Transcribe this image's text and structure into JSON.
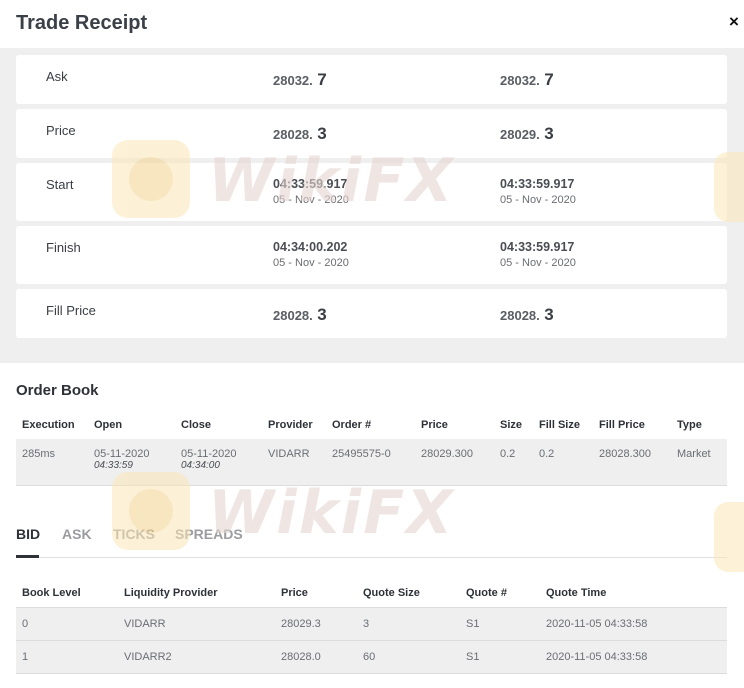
{
  "modal": {
    "title": "Trade Receipt",
    "close_label": "×"
  },
  "summary": {
    "rows": [
      {
        "label": "Ask",
        "col1": {
          "price_small": "28032.",
          "price_big": "7"
        },
        "col2": {
          "price_small": "28032.",
          "price_big": "7"
        }
      },
      {
        "label": "Price",
        "col1": {
          "price_small": "28028.",
          "price_big": "3"
        },
        "col2": {
          "price_small": "28029.",
          "price_big": "3"
        }
      },
      {
        "label": "Start",
        "col1": {
          "time": "04:33:59.917",
          "date": "05 - Nov - 2020"
        },
        "col2": {
          "time": "04:33:59.917",
          "date": "05 - Nov - 2020"
        }
      },
      {
        "label": "Finish",
        "col1": {
          "time": "04:34:00.202",
          "date": "05 - Nov - 2020"
        },
        "col2": {
          "time": "04:33:59.917",
          "date": "05 - Nov - 2020"
        }
      },
      {
        "label": "Fill Price",
        "col1": {
          "price_small": "28028.",
          "price_big": "3"
        },
        "col2": {
          "price_small": "28028.",
          "price_big": "3"
        }
      }
    ]
  },
  "order_book": {
    "title": "Order Book",
    "headers": [
      "Execution",
      "Open",
      "Close",
      "Provider",
      "Order #",
      "Price",
      "Size",
      "Fill Size",
      "Fill Price",
      "Type"
    ],
    "row": {
      "execution": "285ms",
      "open_date": "05-11-2020",
      "open_time": "04:33:59",
      "close_date": "05-11-2020",
      "close_time": "04:34:00",
      "provider": "VIDARR",
      "order_no": "25495575-0",
      "price": "28029.300",
      "size": "0.2",
      "fill_size": "0.2",
      "fill_price": "28028.300",
      "type": "Market"
    }
  },
  "tabs": [
    "BID",
    "ASK",
    "TICKS",
    "SPREADS"
  ],
  "active_tab": "BID",
  "book": {
    "headers": [
      "Book Level",
      "Liquidity Provider",
      "Price",
      "Quote Size",
      "Quote #",
      "Quote Time"
    ],
    "rows": [
      [
        "0",
        "VIDARR",
        "28029.3",
        "3",
        "S1",
        "2020-11-05 04:33:58"
      ],
      [
        "1",
        "VIDARR2",
        "28028.0",
        "60",
        "S1",
        "2020-11-05 04:33:58"
      ]
    ]
  },
  "watermark": {
    "text": "WikiFX",
    "icon": "wikifx-logo-icon"
  }
}
